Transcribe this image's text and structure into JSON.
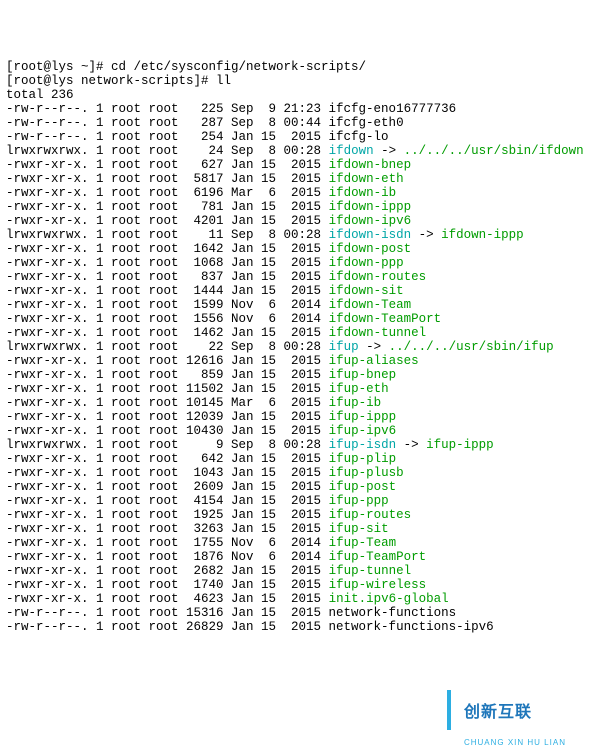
{
  "prompt_host": "[root@lys ~]# ",
  "cmd_cd": "cd /etc/sysconfig/network-scripts/",
  "prompt_dir": "[root@lys network-scripts]# ",
  "cmd_ll": "ll",
  "total_line": "total 236",
  "cols": {
    "perm": {
      "width": 11
    },
    "nlink": {
      "width": 2
    },
    "owner": "root",
    "group": "root"
  },
  "entries": [
    {
      "perm": "-rw-r--r--.",
      "n": "1",
      "size": "225",
      "date": "Sep  9 21:23",
      "name": "ifcfg-eno16777736",
      "cls": ""
    },
    {
      "perm": "-rw-r--r--.",
      "n": "1",
      "size": "287",
      "date": "Sep  8 00:44",
      "name": "ifcfg-eth0",
      "cls": ""
    },
    {
      "perm": "-rw-r--r--.",
      "n": "1",
      "size": "254",
      "date": "Jan 15  2015",
      "name": "ifcfg-lo",
      "cls": ""
    },
    {
      "perm": "lrwxrwxrwx.",
      "n": "1",
      "size": "24",
      "date": "Sep  8 00:28",
      "name": "ifdown",
      "cls": "cyan",
      "arrow": "->",
      "target": "../../../usr/sbin/ifdown",
      "tcls": "green"
    },
    {
      "perm": "-rwxr-xr-x.",
      "n": "1",
      "size": "627",
      "date": "Jan 15  2015",
      "name": "ifdown-bnep",
      "cls": "green"
    },
    {
      "perm": "-rwxr-xr-x.",
      "n": "1",
      "size": "5817",
      "date": "Jan 15  2015",
      "name": "ifdown-eth",
      "cls": "green"
    },
    {
      "perm": "-rwxr-xr-x.",
      "n": "1",
      "size": "6196",
      "date": "Mar  6  2015",
      "name": "ifdown-ib",
      "cls": "green"
    },
    {
      "perm": "-rwxr-xr-x.",
      "n": "1",
      "size": "781",
      "date": "Jan 15  2015",
      "name": "ifdown-ippp",
      "cls": "green"
    },
    {
      "perm": "-rwxr-xr-x.",
      "n": "1",
      "size": "4201",
      "date": "Jan 15  2015",
      "name": "ifdown-ipv6",
      "cls": "green"
    },
    {
      "perm": "lrwxrwxrwx.",
      "n": "1",
      "size": "11",
      "date": "Sep  8 00:28",
      "name": "ifdown-isdn",
      "cls": "cyan",
      "arrow": "->",
      "target": "ifdown-ippp",
      "tcls": "green"
    },
    {
      "perm": "-rwxr-xr-x.",
      "n": "1",
      "size": "1642",
      "date": "Jan 15  2015",
      "name": "ifdown-post",
      "cls": "green"
    },
    {
      "perm": "-rwxr-xr-x.",
      "n": "1",
      "size": "1068",
      "date": "Jan 15  2015",
      "name": "ifdown-ppp",
      "cls": "green"
    },
    {
      "perm": "-rwxr-xr-x.",
      "n": "1",
      "size": "837",
      "date": "Jan 15  2015",
      "name": "ifdown-routes",
      "cls": "green"
    },
    {
      "perm": "-rwxr-xr-x.",
      "n": "1",
      "size": "1444",
      "date": "Jan 15  2015",
      "name": "ifdown-sit",
      "cls": "green"
    },
    {
      "perm": "-rwxr-xr-x.",
      "n": "1",
      "size": "1599",
      "date": "Nov  6  2014",
      "name": "ifdown-Team",
      "cls": "green"
    },
    {
      "perm": "-rwxr-xr-x.",
      "n": "1",
      "size": "1556",
      "date": "Nov  6  2014",
      "name": "ifdown-TeamPort",
      "cls": "green"
    },
    {
      "perm": "-rwxr-xr-x.",
      "n": "1",
      "size": "1462",
      "date": "Jan 15  2015",
      "name": "ifdown-tunnel",
      "cls": "green"
    },
    {
      "perm": "lrwxrwxrwx.",
      "n": "1",
      "size": "22",
      "date": "Sep  8 00:28",
      "name": "ifup",
      "cls": "cyan",
      "arrow": "->",
      "target": "../../../usr/sbin/ifup",
      "tcls": "green"
    },
    {
      "perm": "-rwxr-xr-x.",
      "n": "1",
      "size": "12616",
      "date": "Jan 15  2015",
      "name": "ifup-aliases",
      "cls": "green"
    },
    {
      "perm": "-rwxr-xr-x.",
      "n": "1",
      "size": "859",
      "date": "Jan 15  2015",
      "name": "ifup-bnep",
      "cls": "green"
    },
    {
      "perm": "-rwxr-xr-x.",
      "n": "1",
      "size": "11502",
      "date": "Jan 15  2015",
      "name": "ifup-eth",
      "cls": "green"
    },
    {
      "perm": "-rwxr-xr-x.",
      "n": "1",
      "size": "10145",
      "date": "Mar  6  2015",
      "name": "ifup-ib",
      "cls": "green"
    },
    {
      "perm": "-rwxr-xr-x.",
      "n": "1",
      "size": "12039",
      "date": "Jan 15  2015",
      "name": "ifup-ippp",
      "cls": "green"
    },
    {
      "perm": "-rwxr-xr-x.",
      "n": "1",
      "size": "10430",
      "date": "Jan 15  2015",
      "name": "ifup-ipv6",
      "cls": "green"
    },
    {
      "perm": "lrwxrwxrwx.",
      "n": "1",
      "size": "9",
      "date": "Sep  8 00:28",
      "name": "ifup-isdn",
      "cls": "cyan",
      "arrow": "->",
      "target": "ifup-ippp",
      "tcls": "green"
    },
    {
      "perm": "-rwxr-xr-x.",
      "n": "1",
      "size": "642",
      "date": "Jan 15  2015",
      "name": "ifup-plip",
      "cls": "green"
    },
    {
      "perm": "-rwxr-xr-x.",
      "n": "1",
      "size": "1043",
      "date": "Jan 15  2015",
      "name": "ifup-plusb",
      "cls": "green"
    },
    {
      "perm": "-rwxr-xr-x.",
      "n": "1",
      "size": "2609",
      "date": "Jan 15  2015",
      "name": "ifup-post",
      "cls": "green"
    },
    {
      "perm": "-rwxr-xr-x.",
      "n": "1",
      "size": "4154",
      "date": "Jan 15  2015",
      "name": "ifup-ppp",
      "cls": "green"
    },
    {
      "perm": "-rwxr-xr-x.",
      "n": "1",
      "size": "1925",
      "date": "Jan 15  2015",
      "name": "ifup-routes",
      "cls": "green"
    },
    {
      "perm": "-rwxr-xr-x.",
      "n": "1",
      "size": "3263",
      "date": "Jan 15  2015",
      "name": "ifup-sit",
      "cls": "green"
    },
    {
      "perm": "-rwxr-xr-x.",
      "n": "1",
      "size": "1755",
      "date": "Nov  6  2014",
      "name": "ifup-Team",
      "cls": "green"
    },
    {
      "perm": "-rwxr-xr-x.",
      "n": "1",
      "size": "1876",
      "date": "Nov  6  2014",
      "name": "ifup-TeamPort",
      "cls": "green"
    },
    {
      "perm": "-rwxr-xr-x.",
      "n": "1",
      "size": "2682",
      "date": "Jan 15  2015",
      "name": "ifup-tunnel",
      "cls": "green"
    },
    {
      "perm": "-rwxr-xr-x.",
      "n": "1",
      "size": "1740",
      "date": "Jan 15  2015",
      "name": "ifup-wireless",
      "cls": "green"
    },
    {
      "perm": "-rwxr-xr-x.",
      "n": "1",
      "size": "4623",
      "date": "Jan 15  2015",
      "name": "init.ipv6-global",
      "cls": "green"
    },
    {
      "perm": "-rw-r--r--.",
      "n": "1",
      "size": "15316",
      "date": "Jan 15  2015",
      "name": "network-functions",
      "cls": ""
    },
    {
      "perm": "-rw-r--r--.",
      "n": "1",
      "size": "26829",
      "date": "Jan 15  2015",
      "name": "network-functions-ipv6",
      "cls": ""
    }
  ],
  "watermark": {
    "big": "创新互联",
    "small": "CHUANG XIN HU LIAN",
    "icon": "CX"
  }
}
